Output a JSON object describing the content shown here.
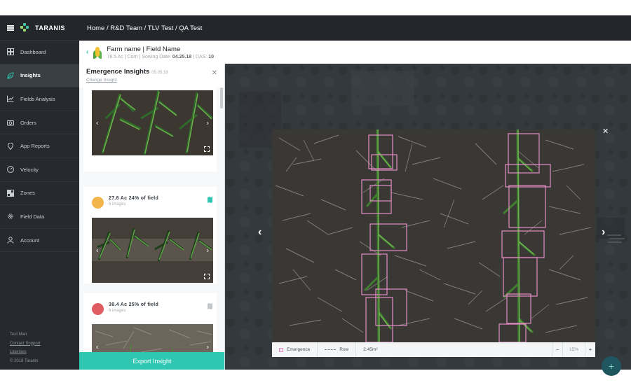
{
  "app": {
    "brand": "TARANIS"
  },
  "breadcrumb": "Home / R&D Team / TLV Test / QA Test",
  "sidebar": {
    "items": [
      {
        "label": "Dashboard",
        "icon": "dashboard-icon"
      },
      {
        "label": "Insights",
        "icon": "leaf-icon",
        "active": true
      },
      {
        "label": "Fields Analysis",
        "icon": "chart-icon"
      },
      {
        "label": "Orders",
        "icon": "camera-icon"
      },
      {
        "label": "App Reports",
        "icon": "pin-icon"
      },
      {
        "label": "Velocity",
        "icon": "gauge-icon"
      },
      {
        "label": "Zones",
        "icon": "zones-icon"
      },
      {
        "label": "Field Data",
        "icon": "gear-icon"
      },
      {
        "label": "Account",
        "icon": "user-icon"
      }
    ],
    "footer": {
      "user": "Test Man",
      "contact": "Contact Support",
      "licenses": "Licenses",
      "copyright": "© 2018 Taranis"
    }
  },
  "field": {
    "title": "Farm name | Field Name",
    "acres": "78.5 Ac",
    "crop": "Corn",
    "sowing_label": "Sowing Date:",
    "sowing_date": "04.25.18",
    "das_label": "DAS:",
    "das": "10"
  },
  "panel": {
    "title": "Emergence Insights",
    "date": "05.05.18",
    "change_link": "Change Insight",
    "cards": [
      {
        "stat": "27.6 Ac 24% of field",
        "images": "6 images",
        "color": "#f2b54c"
      },
      {
        "stat": "38.4 Ac 25% of field",
        "images": "6 images",
        "color": "#e05c63"
      }
    ],
    "export_label": "Export Insight"
  },
  "viewer": {
    "legend_emergence": "Emergence",
    "legend_row": "Row",
    "area": "2.45m²",
    "zoom": "15%",
    "zoom_out": "−",
    "zoom_in": "+"
  },
  "colors": {
    "accent": "#2fc7b1",
    "box": "#e58ec6"
  }
}
